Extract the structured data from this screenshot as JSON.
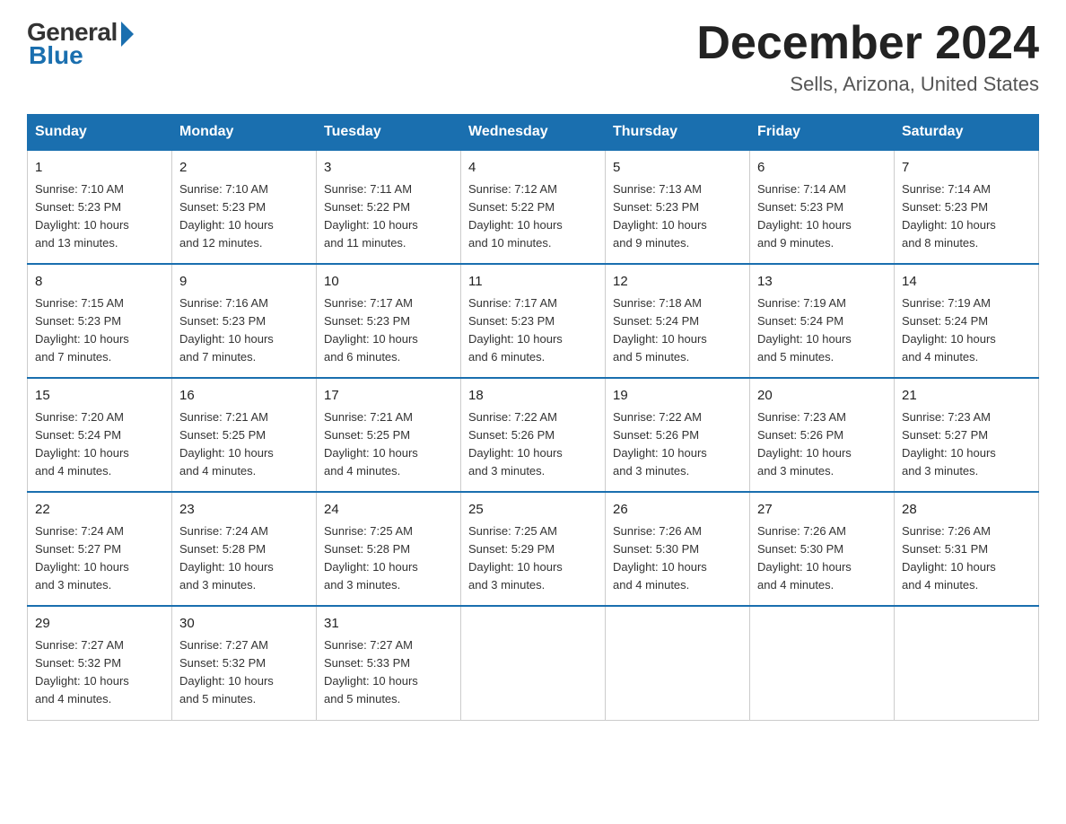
{
  "logo": {
    "general": "General",
    "blue": "Blue"
  },
  "title": "December 2024",
  "location": "Sells, Arizona, United States",
  "days_of_week": [
    "Sunday",
    "Monday",
    "Tuesday",
    "Wednesday",
    "Thursday",
    "Friday",
    "Saturday"
  ],
  "weeks": [
    [
      {
        "day": "1",
        "info": "Sunrise: 7:10 AM\nSunset: 5:23 PM\nDaylight: 10 hours\nand 13 minutes."
      },
      {
        "day": "2",
        "info": "Sunrise: 7:10 AM\nSunset: 5:23 PM\nDaylight: 10 hours\nand 12 minutes."
      },
      {
        "day": "3",
        "info": "Sunrise: 7:11 AM\nSunset: 5:22 PM\nDaylight: 10 hours\nand 11 minutes."
      },
      {
        "day": "4",
        "info": "Sunrise: 7:12 AM\nSunset: 5:22 PM\nDaylight: 10 hours\nand 10 minutes."
      },
      {
        "day": "5",
        "info": "Sunrise: 7:13 AM\nSunset: 5:23 PM\nDaylight: 10 hours\nand 9 minutes."
      },
      {
        "day": "6",
        "info": "Sunrise: 7:14 AM\nSunset: 5:23 PM\nDaylight: 10 hours\nand 9 minutes."
      },
      {
        "day": "7",
        "info": "Sunrise: 7:14 AM\nSunset: 5:23 PM\nDaylight: 10 hours\nand 8 minutes."
      }
    ],
    [
      {
        "day": "8",
        "info": "Sunrise: 7:15 AM\nSunset: 5:23 PM\nDaylight: 10 hours\nand 7 minutes."
      },
      {
        "day": "9",
        "info": "Sunrise: 7:16 AM\nSunset: 5:23 PM\nDaylight: 10 hours\nand 7 minutes."
      },
      {
        "day": "10",
        "info": "Sunrise: 7:17 AM\nSunset: 5:23 PM\nDaylight: 10 hours\nand 6 minutes."
      },
      {
        "day": "11",
        "info": "Sunrise: 7:17 AM\nSunset: 5:23 PM\nDaylight: 10 hours\nand 6 minutes."
      },
      {
        "day": "12",
        "info": "Sunrise: 7:18 AM\nSunset: 5:24 PM\nDaylight: 10 hours\nand 5 minutes."
      },
      {
        "day": "13",
        "info": "Sunrise: 7:19 AM\nSunset: 5:24 PM\nDaylight: 10 hours\nand 5 minutes."
      },
      {
        "day": "14",
        "info": "Sunrise: 7:19 AM\nSunset: 5:24 PM\nDaylight: 10 hours\nand 4 minutes."
      }
    ],
    [
      {
        "day": "15",
        "info": "Sunrise: 7:20 AM\nSunset: 5:24 PM\nDaylight: 10 hours\nand 4 minutes."
      },
      {
        "day": "16",
        "info": "Sunrise: 7:21 AM\nSunset: 5:25 PM\nDaylight: 10 hours\nand 4 minutes."
      },
      {
        "day": "17",
        "info": "Sunrise: 7:21 AM\nSunset: 5:25 PM\nDaylight: 10 hours\nand 4 minutes."
      },
      {
        "day": "18",
        "info": "Sunrise: 7:22 AM\nSunset: 5:26 PM\nDaylight: 10 hours\nand 3 minutes."
      },
      {
        "day": "19",
        "info": "Sunrise: 7:22 AM\nSunset: 5:26 PM\nDaylight: 10 hours\nand 3 minutes."
      },
      {
        "day": "20",
        "info": "Sunrise: 7:23 AM\nSunset: 5:26 PM\nDaylight: 10 hours\nand 3 minutes."
      },
      {
        "day": "21",
        "info": "Sunrise: 7:23 AM\nSunset: 5:27 PM\nDaylight: 10 hours\nand 3 minutes."
      }
    ],
    [
      {
        "day": "22",
        "info": "Sunrise: 7:24 AM\nSunset: 5:27 PM\nDaylight: 10 hours\nand 3 minutes."
      },
      {
        "day": "23",
        "info": "Sunrise: 7:24 AM\nSunset: 5:28 PM\nDaylight: 10 hours\nand 3 minutes."
      },
      {
        "day": "24",
        "info": "Sunrise: 7:25 AM\nSunset: 5:28 PM\nDaylight: 10 hours\nand 3 minutes."
      },
      {
        "day": "25",
        "info": "Sunrise: 7:25 AM\nSunset: 5:29 PM\nDaylight: 10 hours\nand 3 minutes."
      },
      {
        "day": "26",
        "info": "Sunrise: 7:26 AM\nSunset: 5:30 PM\nDaylight: 10 hours\nand 4 minutes."
      },
      {
        "day": "27",
        "info": "Sunrise: 7:26 AM\nSunset: 5:30 PM\nDaylight: 10 hours\nand 4 minutes."
      },
      {
        "day": "28",
        "info": "Sunrise: 7:26 AM\nSunset: 5:31 PM\nDaylight: 10 hours\nand 4 minutes."
      }
    ],
    [
      {
        "day": "29",
        "info": "Sunrise: 7:27 AM\nSunset: 5:32 PM\nDaylight: 10 hours\nand 4 minutes."
      },
      {
        "day": "30",
        "info": "Sunrise: 7:27 AM\nSunset: 5:32 PM\nDaylight: 10 hours\nand 5 minutes."
      },
      {
        "day": "31",
        "info": "Sunrise: 7:27 AM\nSunset: 5:33 PM\nDaylight: 10 hours\nand 5 minutes."
      },
      {
        "day": "",
        "info": ""
      },
      {
        "day": "",
        "info": ""
      },
      {
        "day": "",
        "info": ""
      },
      {
        "day": "",
        "info": ""
      }
    ]
  ]
}
